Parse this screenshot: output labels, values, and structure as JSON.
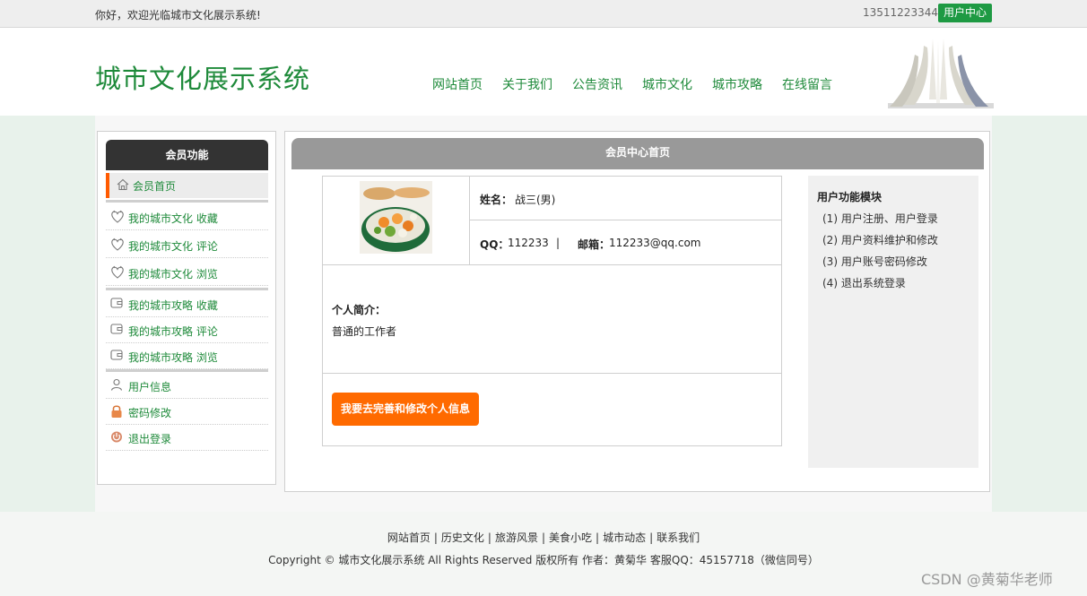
{
  "topbar": {
    "welcome": "你好，欢迎光临城市文化展示系统!",
    "phone": "13511223344",
    "user_center": "用户中心"
  },
  "header": {
    "logo": "城市文化展示系统",
    "nav": [
      "网站首页",
      "关于我们",
      "公告资讯",
      "城市文化",
      "城市攻略",
      "在线留言"
    ]
  },
  "sidebar": {
    "title": "会员功能",
    "home": "会员首页",
    "items": [
      {
        "label": "我的城市文化 收藏",
        "icon": "heart-outline-icon"
      },
      {
        "label": "我的城市文化 评论",
        "icon": "heart-outline-icon"
      },
      {
        "label": "我的城市文化 浏览",
        "icon": "heart-outline-icon"
      },
      {
        "label": "我的城市攻略 收藏",
        "icon": "wallet-icon"
      },
      {
        "label": "我的城市攻略 评论",
        "icon": "wallet-icon"
      },
      {
        "label": "我的城市攻略 浏览",
        "icon": "wallet-icon"
      },
      {
        "label": "用户信息",
        "icon": "user-icon"
      },
      {
        "label": "密码修改",
        "icon": "lock-icon"
      },
      {
        "label": "退出登录",
        "icon": "power-icon"
      }
    ]
  },
  "content": {
    "title": "会员中心首页",
    "name_label": "姓名：",
    "name_value": "战三(男)",
    "qq_label": "QQ：",
    "qq_value": "112233",
    "qq_sep": "|",
    "email_label": "邮箱：",
    "email_value": "112233@qq.com",
    "intro_label": "个人简介：",
    "intro_value": "普通的工作者",
    "edit_button": "我要去完善和修改个人信息"
  },
  "modules": {
    "title": "用户功能模块",
    "items": [
      "(1) 用户注册、用户登录",
      "(2) 用户资料维护和修改",
      "(3) 用户账号密码修改",
      "(4) 退出系统登录"
    ]
  },
  "footer": {
    "links": [
      "网站首页",
      "历史文化",
      "旅游风景",
      "美食小吃",
      "城市动态",
      "联系我们"
    ],
    "copyright": "Copyright © 城市文化展示系统 All Rights Reserved 版权所有 作者：黄菊华 客服QQ：45157718（微信同号）",
    "watermark": "CSDN @黄菊华老师"
  },
  "colors": {
    "accent_green": "#1e8a3a",
    "accent_orange": "#ff6a00",
    "sidebar_header": "#333333",
    "content_header": "#999999"
  }
}
